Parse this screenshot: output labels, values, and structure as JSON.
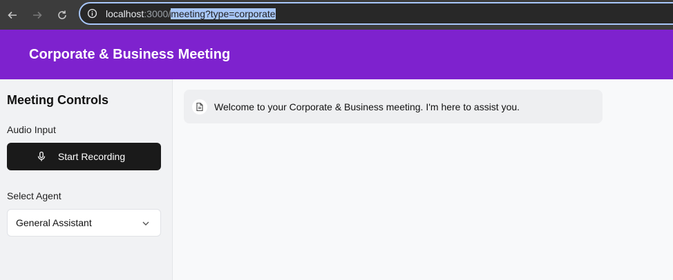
{
  "browser": {
    "url_host": "localhost",
    "url_port": ":3000/",
    "url_path_selected": "meeting?type=corporate"
  },
  "header": {
    "title": "Corporate & Business Meeting",
    "bg_color": "#7e22ce"
  },
  "sidebar": {
    "title": "Meeting Controls",
    "audio_label": "Audio Input",
    "record_button": "Start Recording",
    "agent_label": "Select Agent",
    "agent_selected": "General Assistant"
  },
  "chat": {
    "messages": [
      {
        "icon": "document-icon",
        "text": "Welcome to your Corporate & Business meeting. I'm here to assist you."
      }
    ]
  }
}
